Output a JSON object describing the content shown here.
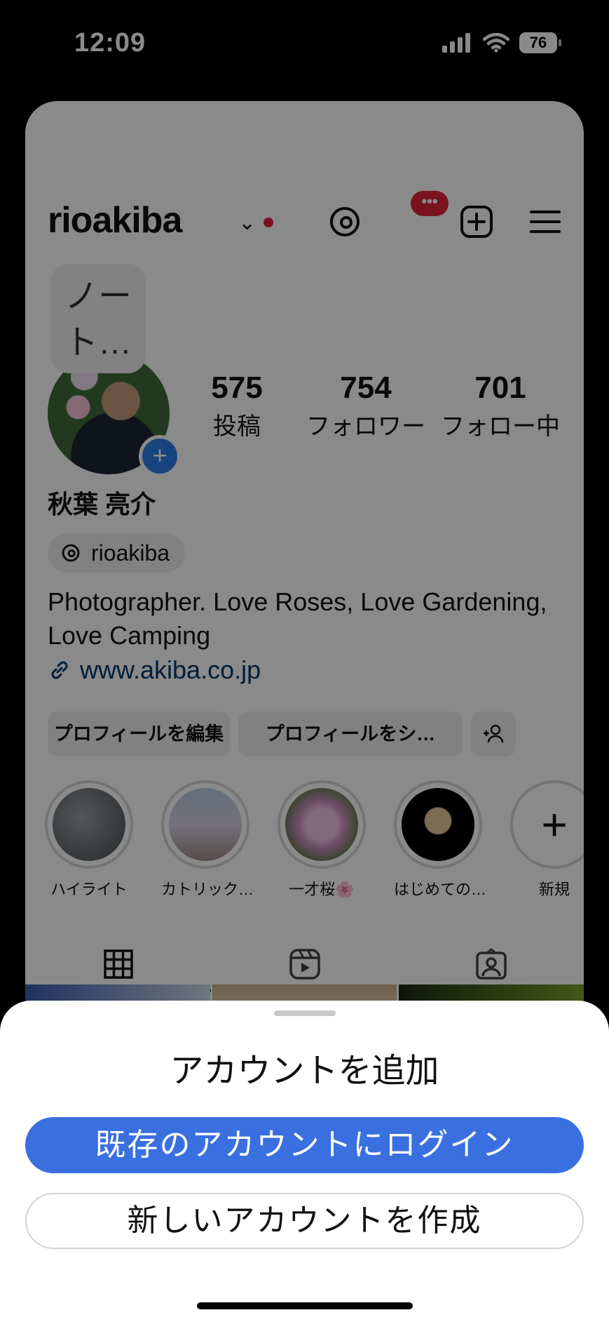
{
  "status_bar": {
    "time": "12:09",
    "battery": "76"
  },
  "profile": {
    "username": "rioakiba",
    "threads_badge": "•••",
    "note": "ノート…",
    "stats": [
      {
        "num": "575",
        "label": "投稿"
      },
      {
        "num": "754",
        "label": "フォロワー"
      },
      {
        "num": "701",
        "label": "フォロー中"
      }
    ],
    "full_name": "秋葉 亮介",
    "threads_handle": "rioakiba",
    "bio": "Photographer. Love Roses, Love Gardening, Love Camping",
    "link": "www.akiba.co.jp",
    "buttons": {
      "edit": "プロフィールを編集",
      "share": "プロフィールをシ…"
    }
  },
  "highlights": [
    {
      "label": "ハイライト"
    },
    {
      "label": "カトリック…"
    },
    {
      "label": "一才桜🌸"
    },
    {
      "label": "はじめての…"
    },
    {
      "label": "新規"
    }
  ],
  "sheet": {
    "title": "アカウントを追加",
    "login_button": "既存のアカウントにログイン",
    "create_button": "新しいアカウントを作成"
  },
  "colors": {
    "accent": "#3a6fe0",
    "notification": "#e0243b",
    "link": "#00376b"
  }
}
